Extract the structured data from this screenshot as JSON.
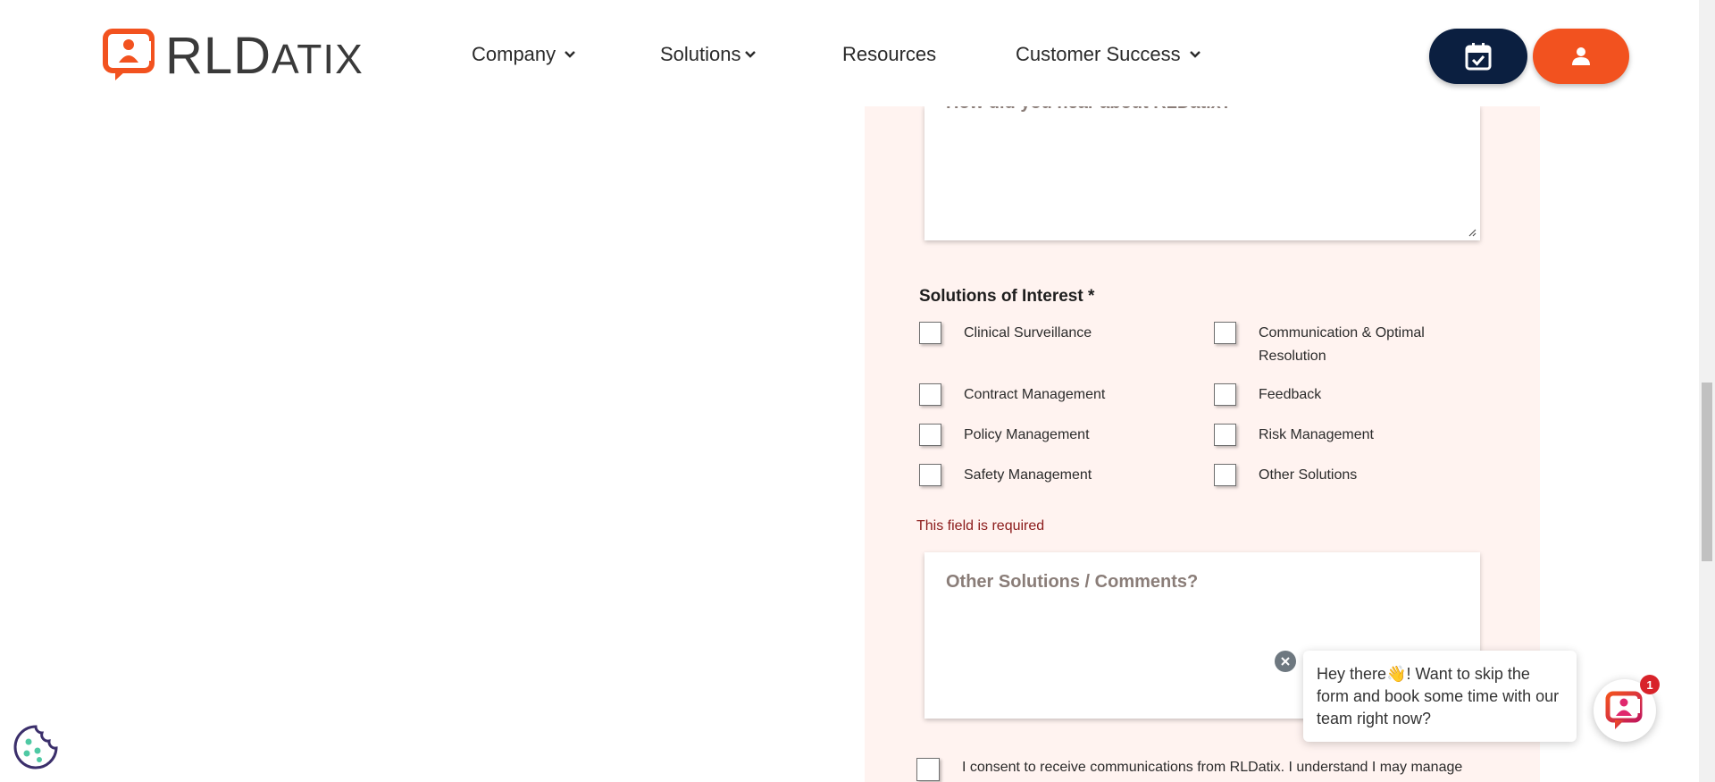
{
  "brand": {
    "logo_text_big": "RLD",
    "logo_text_small": "ATIX",
    "primary_color": "#f2521f",
    "navy_color": "#0b1f40",
    "panel_bg": "#fff3f0"
  },
  "nav": {
    "company": "Company",
    "solutions": "Solutions",
    "resources": "Resources",
    "customer_success": "Customer Success"
  },
  "header_buttons": {
    "calendar_icon": "calendar-check-icon",
    "user_icon": "user-icon"
  },
  "form": {
    "hear_about_placeholder": "How did you hear about RLDatix?",
    "solutions_title": "Solutions of Interest *",
    "solutions": [
      "Clinical Surveillance",
      "Communication & Optimal Resolution",
      "Contract Management",
      "Feedback",
      "Policy Management",
      "Risk Management",
      "Safety Management",
      "Other Solutions"
    ],
    "error_text": "This field is required",
    "comments_placeholder": "Other Solutions / Comments?",
    "consent_text": "I consent to receive communications from RLDatix. I understand I may manage"
  },
  "chat": {
    "message_line1": "Hey there",
    "wave": "👋",
    "message_rest": "! Want to skip the form and book some time with our team right now?",
    "badge_count": "1"
  }
}
